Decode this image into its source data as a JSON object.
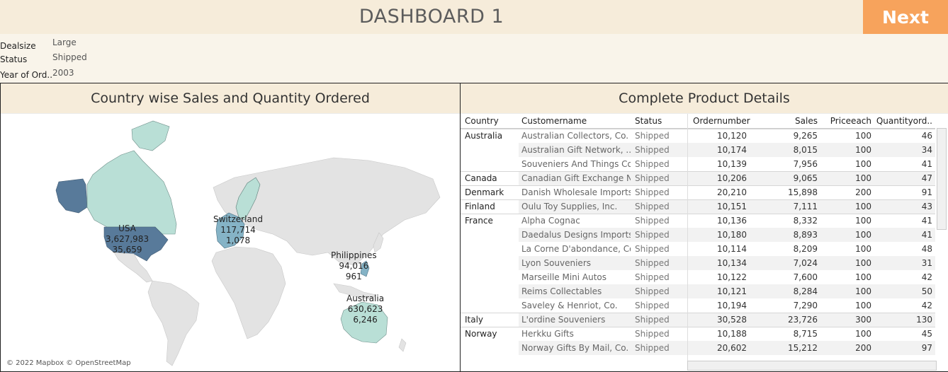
{
  "header": {
    "title": "DASHBOARD 1",
    "next_label": "Next"
  },
  "filters": [
    {
      "label": "Dealsize",
      "value": "Large"
    },
    {
      "label": "Status",
      "value": "Shipped"
    },
    {
      "label": "Year of Ord..",
      "value": "2003"
    }
  ],
  "map": {
    "title": "Country wise Sales and Quantity Ordered",
    "copyright": "© 2022 Mapbox © OpenStreetMap",
    "labels": [
      {
        "country": "USA",
        "sales": "3,627,983",
        "qty": "35,659"
      },
      {
        "country": "Switzerland",
        "sales": "117,714",
        "qty": "1,078"
      },
      {
        "country": "Philippines",
        "sales": "94,016",
        "qty": "961"
      },
      {
        "country": "Australia",
        "sales": "630,623",
        "qty": "6,246"
      }
    ],
    "colors": {
      "dark": "#587a9a",
      "mid": "#85b3c6",
      "light": "#b9dfd6",
      "land": "#e3e3e3"
    }
  },
  "table": {
    "title": "Complete Product Details",
    "columns": [
      "Country",
      "Customername",
      "Status",
      "Ordernumber",
      "Sales",
      "Priceeach",
      "Quantityord.."
    ],
    "rows": [
      {
        "country": "Australia",
        "customer": "Australian Collectors, Co.",
        "status": "Shipped",
        "order": "10,120",
        "sales": "9,265",
        "price": "100",
        "qty": "46"
      },
      {
        "country": "",
        "customer": "Australian Gift Network, ..",
        "status": "Shipped",
        "order": "10,174",
        "sales": "8,015",
        "price": "100",
        "qty": "34"
      },
      {
        "country": "",
        "customer": "Souveniers And Things Co.",
        "status": "Shipped",
        "order": "10,139",
        "sales": "7,956",
        "price": "100",
        "qty": "41"
      },
      {
        "country": "Canada",
        "customer": "Canadian Gift Exchange N..",
        "status": "Shipped",
        "order": "10,206",
        "sales": "9,065",
        "price": "100",
        "qty": "47"
      },
      {
        "country": "Denmark",
        "customer": "Danish Wholesale Imports",
        "status": "Shipped",
        "order": "20,210",
        "sales": "15,898",
        "price": "200",
        "qty": "91"
      },
      {
        "country": "Finland",
        "customer": "Oulu Toy Supplies, Inc.",
        "status": "Shipped",
        "order": "10,151",
        "sales": "7,111",
        "price": "100",
        "qty": "43"
      },
      {
        "country": "France",
        "customer": "Alpha Cognac",
        "status": "Shipped",
        "order": "10,136",
        "sales": "8,332",
        "price": "100",
        "qty": "41"
      },
      {
        "country": "",
        "customer": "Daedalus Designs Imports",
        "status": "Shipped",
        "order": "10,180",
        "sales": "8,893",
        "price": "100",
        "qty": "41"
      },
      {
        "country": "",
        "customer": "La Corne D'abondance, Co.",
        "status": "Shipped",
        "order": "10,114",
        "sales": "8,209",
        "price": "100",
        "qty": "48"
      },
      {
        "country": "",
        "customer": "Lyon Souveniers",
        "status": "Shipped",
        "order": "10,134",
        "sales": "7,024",
        "price": "100",
        "qty": "31"
      },
      {
        "country": "",
        "customer": "Marseille Mini Autos",
        "status": "Shipped",
        "order": "10,122",
        "sales": "7,600",
        "price": "100",
        "qty": "42"
      },
      {
        "country": "",
        "customer": "Reims Collectables",
        "status": "Shipped",
        "order": "10,121",
        "sales": "8,284",
        "price": "100",
        "qty": "50"
      },
      {
        "country": "",
        "customer": "Saveley & Henriot, Co.",
        "status": "Shipped",
        "order": "10,194",
        "sales": "7,290",
        "price": "100",
        "qty": "42"
      },
      {
        "country": "Italy",
        "customer": "L'ordine Souveniers",
        "status": "Shipped",
        "order": "30,528",
        "sales": "23,726",
        "price": "300",
        "qty": "130"
      },
      {
        "country": "Norway",
        "customer": "Herkku Gifts",
        "status": "Shipped",
        "order": "10,188",
        "sales": "8,715",
        "price": "100",
        "qty": "45"
      },
      {
        "country": "",
        "customer": "Norway Gifts By Mail, Co.",
        "status": "Shipped",
        "order": "20,602",
        "sales": "15,212",
        "price": "200",
        "qty": "97"
      }
    ]
  }
}
